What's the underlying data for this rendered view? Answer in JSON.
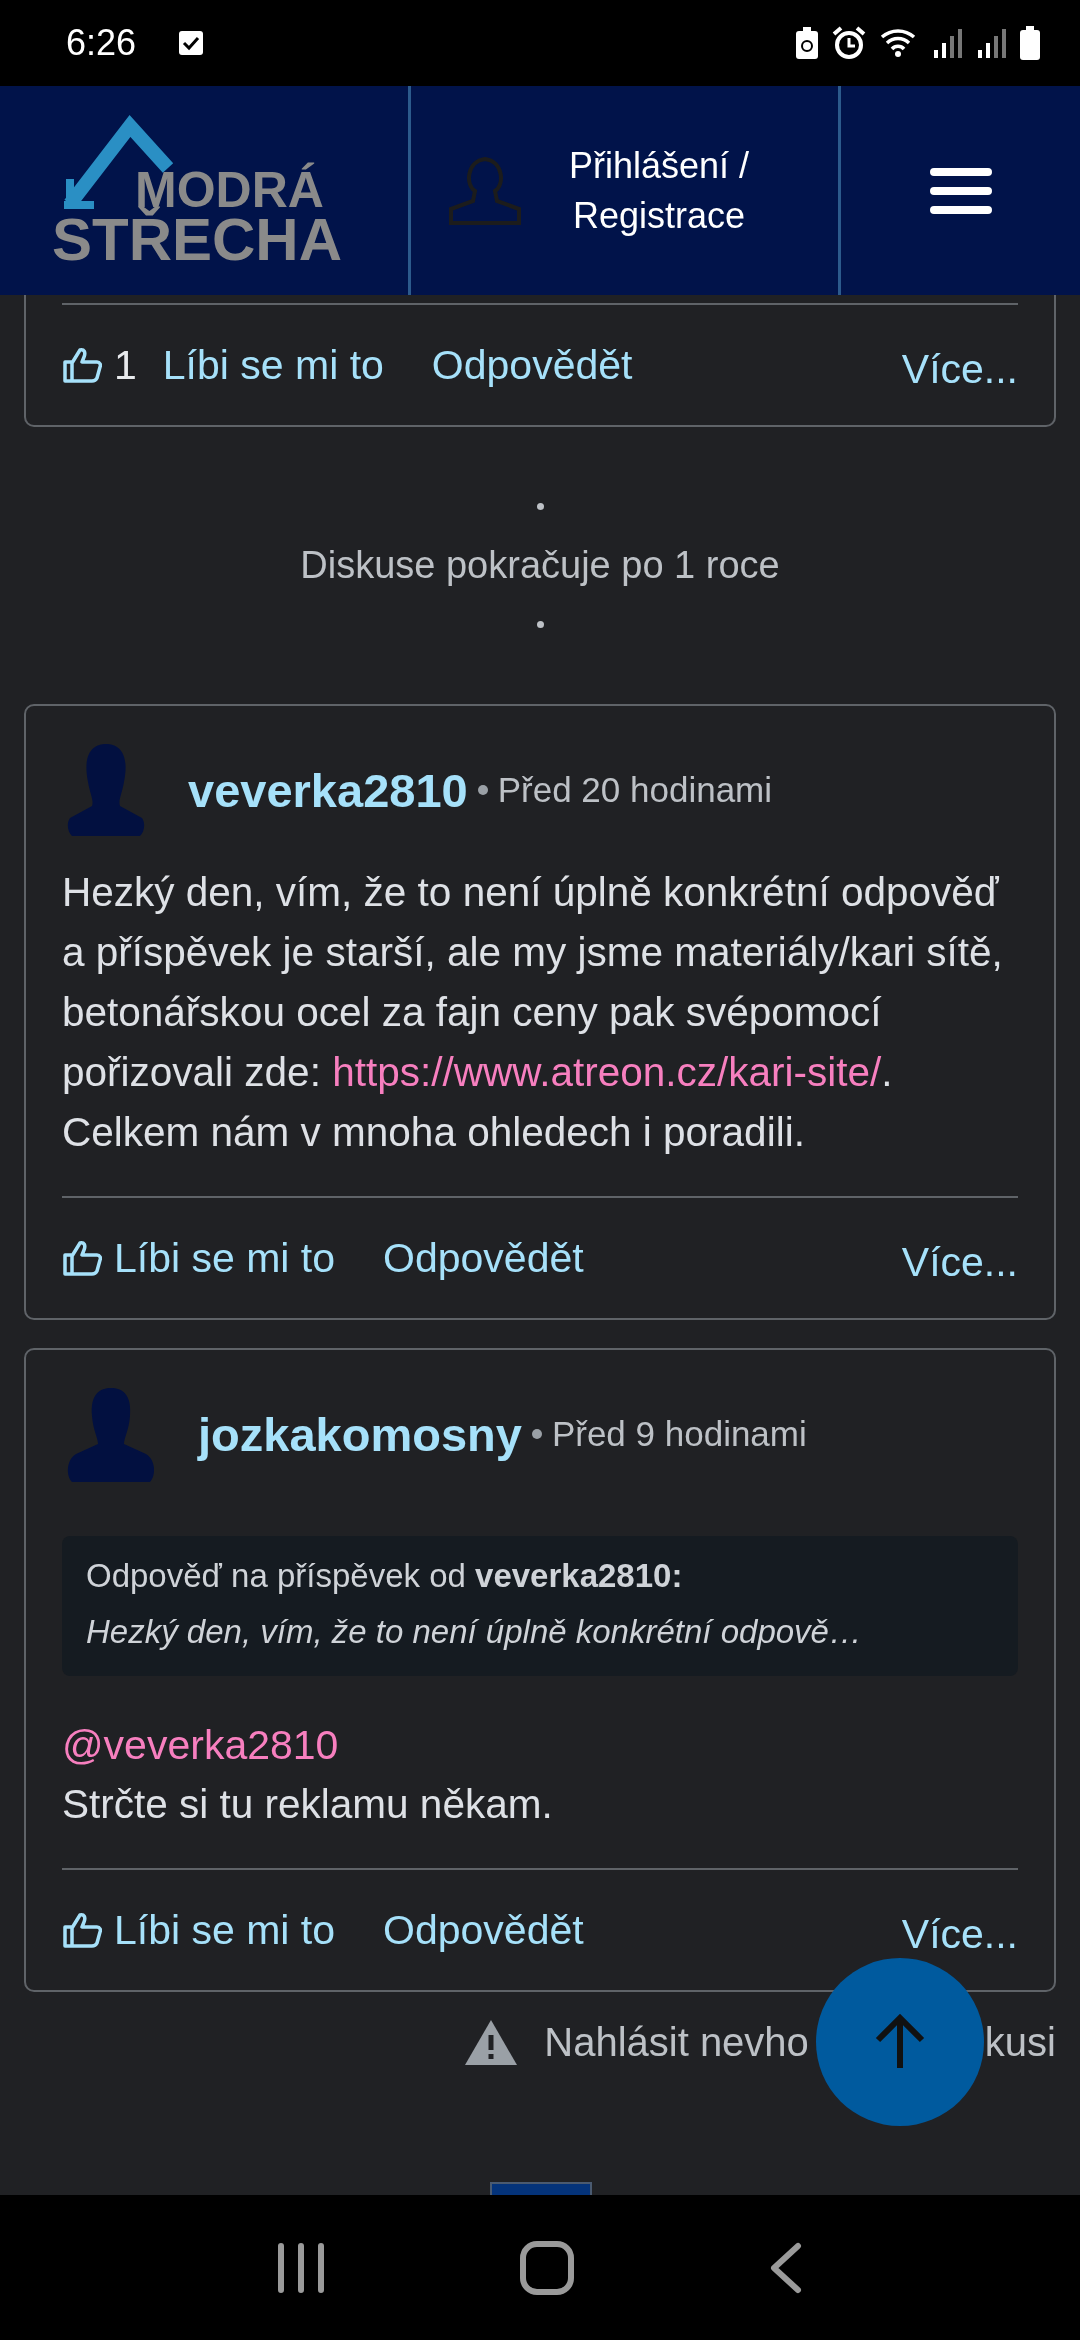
{
  "status_bar": {
    "time": "6:26"
  },
  "header": {
    "logo": {
      "line1": "MODRÁ",
      "line2": "STŘECHA"
    },
    "login_lines": [
      "Přihlášení /",
      "Registrace"
    ]
  },
  "posts": [
    {
      "kind": "partial",
      "footer": {
        "like_count": "1",
        "like": "Líbi se mi to",
        "reply": "Odpovědět",
        "more": "Více..."
      }
    },
    {
      "kind": "separator",
      "text": "Diskuse pokračuje po 1 roce"
    },
    {
      "kind": "full",
      "avatar": {
        "kind": "female"
      },
      "author": "veverka2810",
      "time": "Před 20 hodinami",
      "body": [
        {
          "kind": "text",
          "text": "Hezký den, vím, že to není úplně konkrétní odpověď a příspěvek je starší, ale my jsme materiály/kari sítě, betonářskou ocel za fajn ceny pak svépomocí pořizovali zde: "
        },
        {
          "kind": "link",
          "text": "https://www.atreon.cz/kari-site/"
        },
        {
          "kind": "text",
          "text": ". Celkem nám v mnoha ohledech i poradili."
        }
      ],
      "footer": {
        "like": "Líbi se mi to",
        "reply": "Odpovědět",
        "more": "Více..."
      }
    },
    {
      "kind": "full",
      "avatar": {
        "kind": "male"
      },
      "author": "jozkakomosny",
      "time": "Před 9 hodinami",
      "quote": {
        "heading": "Odpověď na příspěvek od **veverka2810:**",
        "excerpt": "Hezký den, vím, že to není úplně konkrétní odpově…"
      },
      "mention": "@veverka2810",
      "body": [
        {
          "kind": "text",
          "text": "Strčte si tu reklamu někam."
        }
      ],
      "footer": {
        "like": "Líbi se mi to",
        "reply": "Odpovědět",
        "more": "Více..."
      }
    }
  ],
  "report": {
    "parts": [
      "Nahlásit nevho",
      "kusi"
    ]
  }
}
